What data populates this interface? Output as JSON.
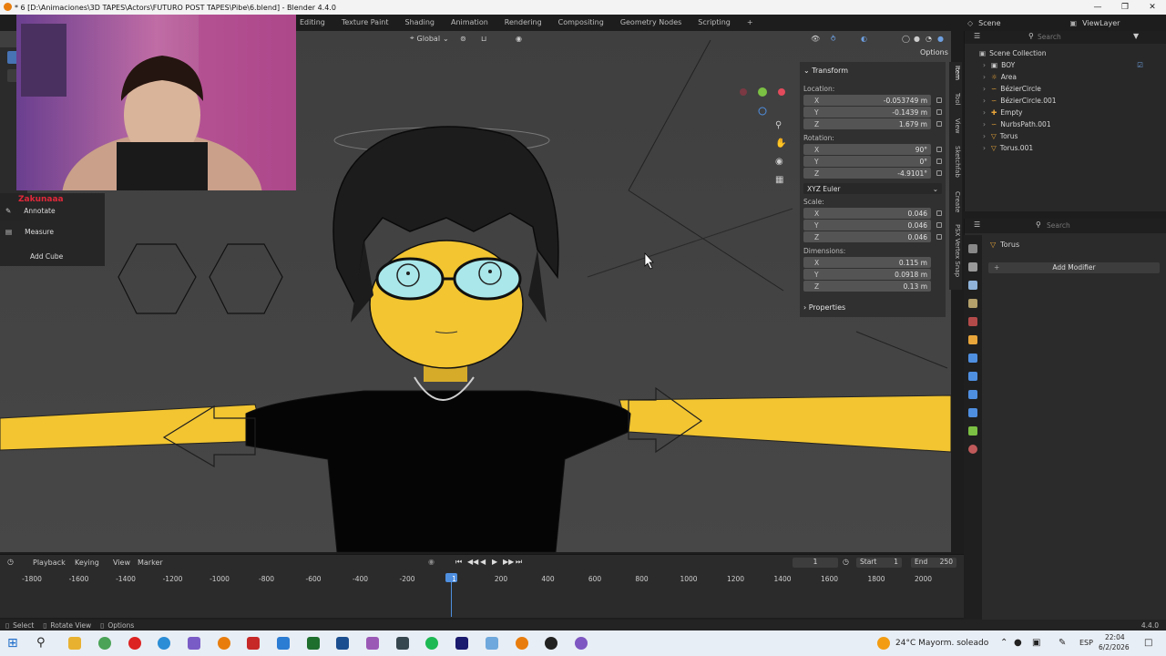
{
  "window": {
    "title": "* 6 [D:\\Animaciones\\3D TAPES\\Actors\\FUTURO POST TAPES\\Pibe\\6.blend] - Blender 4.4.0",
    "controls": [
      "—",
      "❐",
      "✕"
    ]
  },
  "workspaces": [
    "Editing",
    "Texture Paint",
    "Shading",
    "Animation",
    "Rendering",
    "Compositing",
    "Geometry Nodes",
    "Scripting",
    "+"
  ],
  "scene": {
    "label": "Scene",
    "view_layer": "ViewLayer"
  },
  "viewport_header": {
    "orientation": "Global",
    "options_label": "Options"
  },
  "tools_left": {
    "annotate": "Annotate",
    "measure": "Measure",
    "add_cube": "Add Cube",
    "overlay_text": "Zakunaaa"
  },
  "npanel": {
    "transform_title": "Transform",
    "location_label": "Location:",
    "location": [
      {
        "axis": "X",
        "value": "-0.053749 m"
      },
      {
        "axis": "Y",
        "value": "-0.1439 m"
      },
      {
        "axis": "Z",
        "value": "1.679 m"
      }
    ],
    "rotation_label": "Rotation:",
    "rotation": [
      {
        "axis": "X",
        "value": "90°"
      },
      {
        "axis": "Y",
        "value": "0°"
      },
      {
        "axis": "Z",
        "value": "-4.9101°"
      }
    ],
    "rotation_mode": "XYZ Euler",
    "scale_label": "Scale:",
    "scale": [
      {
        "axis": "X",
        "value": "0.046"
      },
      {
        "axis": "Y",
        "value": "0.046"
      },
      {
        "axis": "Z",
        "value": "0.046"
      }
    ],
    "dimensions_label": "Dimensions:",
    "dimensions": [
      {
        "axis": "X",
        "value": "0.115 m"
      },
      {
        "axis": "Y",
        "value": "0.0918 m"
      },
      {
        "axis": "Z",
        "value": "0.13 m"
      }
    ],
    "properties_title": "Properties",
    "tabs": [
      "Item",
      "Tool",
      "View",
      "Sketchfab",
      "Create",
      "PSX Vertex Snap"
    ]
  },
  "outliner": {
    "search_placeholder": "Search",
    "root": "Scene Collection",
    "items": [
      {
        "name": "BOY",
        "type": "collection"
      },
      {
        "name": "Area",
        "type": "light"
      },
      {
        "name": "BézierCircle",
        "type": "curve"
      },
      {
        "name": "BézierCircle.001",
        "type": "curve"
      },
      {
        "name": "Empty",
        "type": "empty"
      },
      {
        "name": "NurbsPath.001",
        "type": "curve"
      },
      {
        "name": "Torus",
        "type": "mesh"
      },
      {
        "name": "Torus.001",
        "type": "mesh"
      }
    ]
  },
  "properties": {
    "search_placeholder": "Search",
    "object_name": "Torus",
    "add_modifier": "Add Modifier"
  },
  "timeline": {
    "menus": [
      "Playback",
      "Keying",
      "View",
      "Marker"
    ],
    "current_frame": "1",
    "start_label": "Start",
    "start": "1",
    "end_label": "End",
    "end": "250",
    "ruler": [
      "-1800",
      "-1600",
      "-1400",
      "-1200",
      "-1000",
      "-800",
      "-600",
      "-400",
      "-200",
      "1",
      "200",
      "400",
      "600",
      "800",
      "1000",
      "1200",
      "1400",
      "1600",
      "1800",
      "2000"
    ]
  },
  "statusbar": {
    "select": "Select",
    "rotate_view": "Rotate View",
    "options": "Options",
    "version": "4.4.0"
  },
  "taskbar": {
    "weather": "24°C  Mayorm. soleado",
    "lang": "ESP",
    "time": "22:04",
    "date": "6/2/2026"
  }
}
